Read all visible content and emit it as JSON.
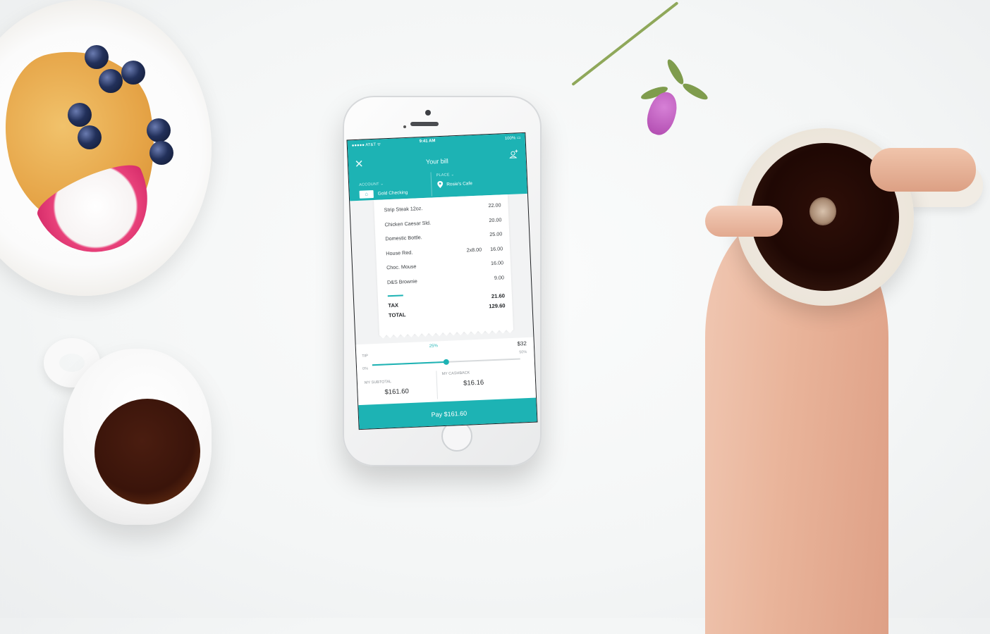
{
  "status": {
    "carrier": "●●●●● AT&T ᯤ",
    "time": "9:41 AM",
    "battery": "100%"
  },
  "header": {
    "title": "Your bill",
    "close_icon": "close-icon",
    "add_user_icon": "add-user-icon"
  },
  "account": {
    "label": "ACCOUNT ⌄",
    "value": "Gold Checking",
    "icon": "bank-icon"
  },
  "place": {
    "label": "PLACE ⌄",
    "value": "Rosie's Cafe",
    "icon": "location-pin-icon"
  },
  "receipt": {
    "items": [
      {
        "name": "Strip Steak 12oz.",
        "qty": "",
        "price": "22.00"
      },
      {
        "name": "Chicken Caesar Sld.",
        "qty": "",
        "price": "20.00"
      },
      {
        "name": "Domestic Bottle.",
        "qty": "",
        "price": "25.00"
      },
      {
        "name": "House Red.",
        "qty": "2x8.00",
        "price": "16.00"
      },
      {
        "name": "Choc. Mouse",
        "qty": "",
        "price": "16.00"
      },
      {
        "name": "D&S Brownie",
        "qty": "",
        "price": "9.00"
      }
    ],
    "tax_label": "TAX",
    "tax_value": "21.60",
    "total_label": "TOTAL",
    "total_value": "129.60"
  },
  "tip": {
    "label": "TIP",
    "percent": "25%",
    "percent_value": 0.5,
    "amount": "$32",
    "min": "0%",
    "max": "50%"
  },
  "subtotal": {
    "label": "MY SUBTOTAL",
    "value": "$161.60"
  },
  "cashback": {
    "label": "MY CASHBACK",
    "value": "$16.16"
  },
  "pay_button": {
    "label": "Pay $161.60"
  },
  "colors": {
    "accent": "#1db3b4"
  }
}
